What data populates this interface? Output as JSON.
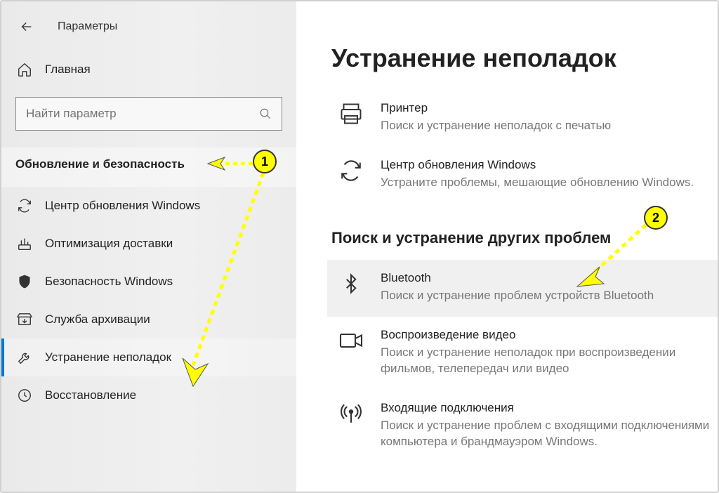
{
  "app": {
    "title": "Параметры"
  },
  "home": {
    "label": "Главная"
  },
  "search": {
    "placeholder": "Найти параметр"
  },
  "sidebar": {
    "section": "Обновление и безопасность",
    "items": [
      {
        "label": "Центр обновления Windows"
      },
      {
        "label": "Оптимизация доставки"
      },
      {
        "label": "Безопасность Windows"
      },
      {
        "label": "Служба архивации"
      },
      {
        "label": "Устранение неполадок"
      },
      {
        "label": "Восстановление"
      }
    ]
  },
  "main": {
    "title": "Устранение неполадок",
    "items": [
      {
        "title": "Принтер",
        "desc": "Поиск и устранение неполадок с печатью"
      },
      {
        "title": "Центр обновления Windows",
        "desc": "Устраните проблемы, мешающие обновлению Windows."
      }
    ],
    "sub_header": "Поиск и устранение других проблем",
    "sub_items": [
      {
        "title": "Bluetooth",
        "desc": "Поиск и устранение проблем устройств Bluetooth"
      },
      {
        "title": "Воспроизведение видео",
        "desc": "Поиск и устранение неполадок при воспроизведении фильмов, телепередач или видео"
      },
      {
        "title": "Входящие подключения",
        "desc": "Поиск и устранение проблем с входящими подключениями компьютера и брандмауэром Windows."
      }
    ]
  },
  "annotations": {
    "badge1": "1",
    "badge2": "2"
  }
}
